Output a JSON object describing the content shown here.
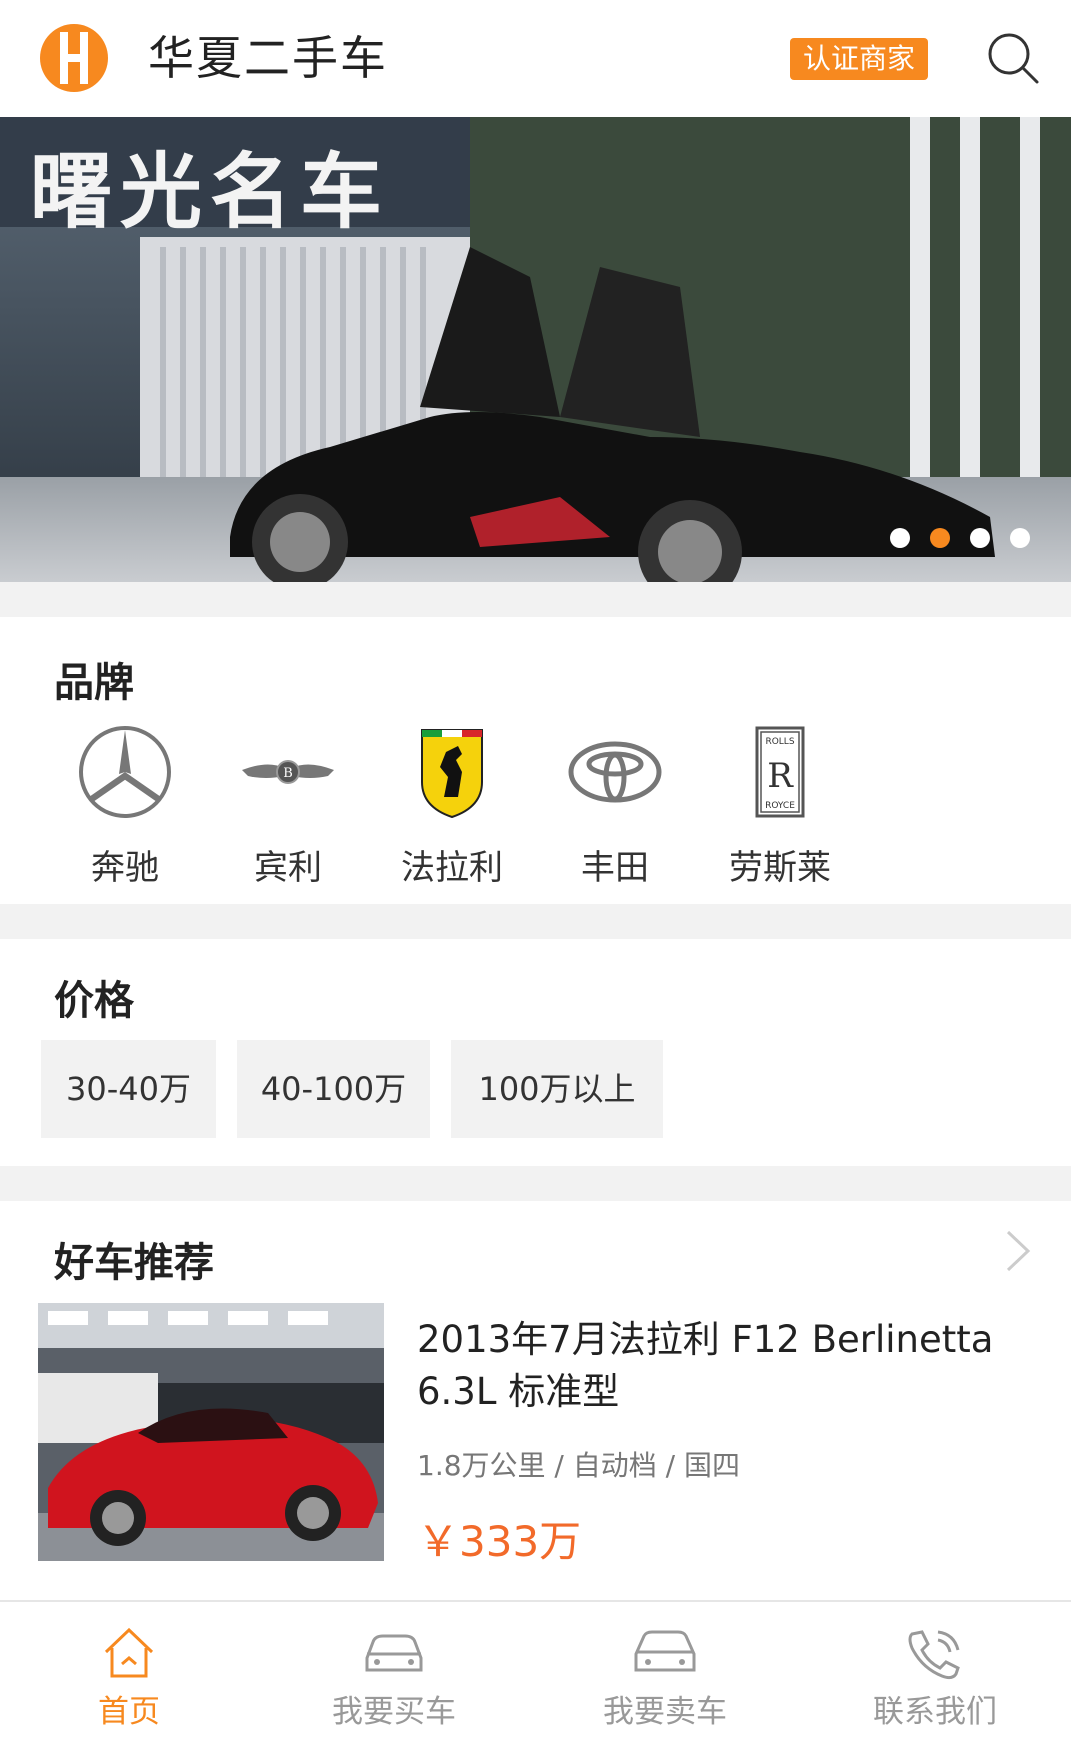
{
  "header": {
    "app_title": "华夏二手车",
    "cert_label": "认证商家",
    "accent": "#f7891f"
  },
  "banner": {
    "sign_text": "曙光名车",
    "active_dot": 1,
    "dot_count": 4
  },
  "brands": {
    "title": "品牌",
    "items": [
      {
        "label": "奔驰",
        "icon": "mercedes-logo-icon"
      },
      {
        "label": "宾利",
        "icon": "bentley-logo-icon"
      },
      {
        "label": "法拉利",
        "icon": "ferrari-logo-icon"
      },
      {
        "label": "丰田",
        "icon": "toyota-logo-icon"
      },
      {
        "label": "劳斯莱",
        "icon": "rolls-royce-logo-icon"
      }
    ]
  },
  "price": {
    "title": "价格",
    "chips": [
      "30-40万",
      "40-100万",
      "100万以上"
    ]
  },
  "recommend": {
    "title": "好车推荐",
    "car": {
      "title": "2013年7月法拉利 F12 Berlinetta 6.3L 标准型",
      "meta": "1.8万公里 / 自动档 / 国四",
      "price": "￥333万",
      "price_color": "#f26a2a"
    }
  },
  "tabbar": {
    "items": [
      {
        "label": "首页",
        "icon": "home-icon",
        "active": true
      },
      {
        "label": "我要买车",
        "icon": "car-front-icon",
        "active": false
      },
      {
        "label": "我要卖车",
        "icon": "car-side-icon",
        "active": false
      },
      {
        "label": "联系我们",
        "icon": "phone-icon",
        "active": false
      }
    ]
  }
}
